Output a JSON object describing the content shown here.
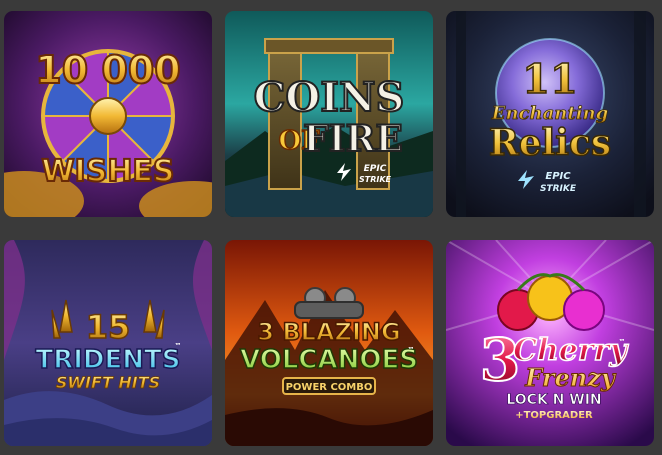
{
  "colors": {
    "page_background": "#3a3a3a"
  },
  "games": [
    {
      "name": "10000 Wishes",
      "line1": "10 000",
      "line2": "WISHES"
    },
    {
      "name": "Coins of Fire",
      "line1": "COINS",
      "line2_a": "OF",
      "line2_b": "FIRE",
      "badge_top": "EPIC",
      "badge_bottom": "STRIKE"
    },
    {
      "name": "11 Enchanting Relics",
      "line1": "11",
      "line2": "Enchanting",
      "line3": "Relics",
      "badge_top": "EPIC",
      "badge_bottom": "STRIKE"
    },
    {
      "name": "15 Tridents Swift Hits",
      "line1": "15",
      "line2": "TRIDENTS",
      "line3": "SWIFT HITS",
      "tm": "™"
    },
    {
      "name": "3 Blazing Volcanoes Power Combo",
      "line1": "3 BLAZING",
      "line2": "VOLCANOES",
      "line3": "POWER COMBO",
      "tm": "™"
    },
    {
      "name": "3 Cherry Frenzy Lock N Win Topgrader",
      "line1": "3",
      "line2": "Cherry",
      "line3": "Frenzy",
      "line4": "LOCK N WIN",
      "line5": "+TOPGRADER",
      "tm": "™"
    }
  ]
}
